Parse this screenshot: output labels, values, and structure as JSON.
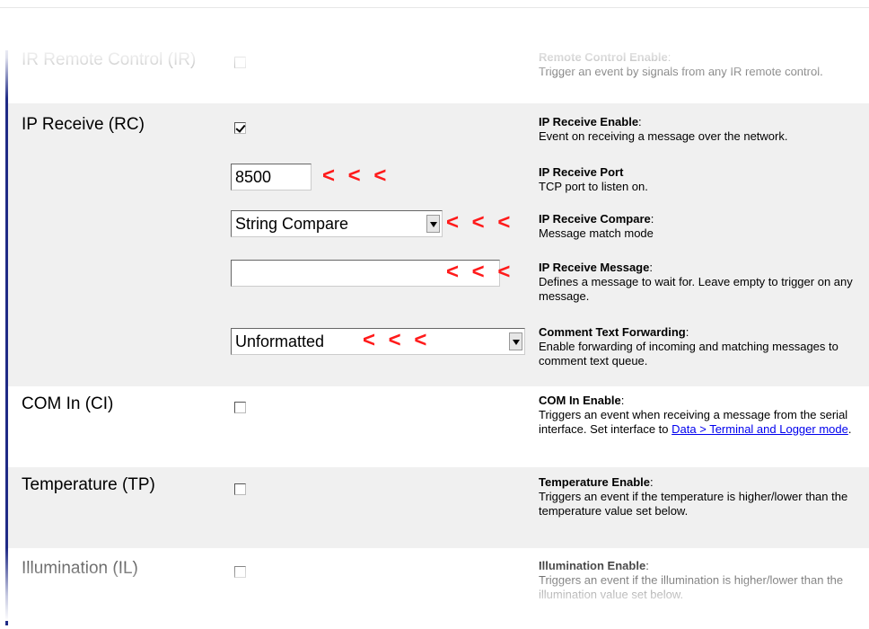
{
  "rows": {
    "ir": {
      "label": "IR Remote Control (IR)",
      "checked": false,
      "desc_title": "Remote Control Enable",
      "desc_text": "Trigger an event by signals from any IR remote control."
    },
    "rc": {
      "label": "IP Receive (RC)",
      "checked": true,
      "enable_title": "IP Receive Enable",
      "enable_text": "Event on receiving a message over the network.",
      "port_value": "8500",
      "port_title": "IP Receive Port",
      "port_text": "TCP port to listen on.",
      "compare_value": "String Compare",
      "compare_title": "IP Receive Compare",
      "compare_text": "Message match mode",
      "message_value": "",
      "message_title": "IP Receive Message",
      "message_text": "Defines a message to wait for. Leave empty to trigger on any message.",
      "forwarding_value": "Unformatted",
      "forwarding_title": "Comment Text Forwarding",
      "forwarding_text": "Enable forwarding of incoming and matching messages to comment text queue."
    },
    "ci": {
      "label": "COM In (CI)",
      "checked": false,
      "desc_title": "COM In Enable",
      "desc_text": "Triggers an event when receiving a message from the serial interface. Set interface to",
      "desc_link": "Data > Terminal and Logger mode",
      "desc_end": "."
    },
    "tp": {
      "label": "Temperature (TP)",
      "checked": false,
      "desc_title": "Temperature Enable",
      "desc_text": "Triggers an event if the temperature is higher/lower than the temperature value set below."
    },
    "il": {
      "label": "Illumination (IL)",
      "checked": false,
      "desc_title": "Illumination Enable",
      "desc_text": "Triggers an event if the illumination is higher/lower than the illumination value set below."
    }
  },
  "annotation": {
    "marker": "< < <",
    "color": "#ff1a1a"
  },
  "colors": {
    "row_shade": "#f0f0f0",
    "left_bar": "#1f2a86",
    "link": "#0000ee"
  },
  "icons": {
    "checkbox_checked": "checkmark",
    "select_arrow": "chevron-down-icon"
  }
}
